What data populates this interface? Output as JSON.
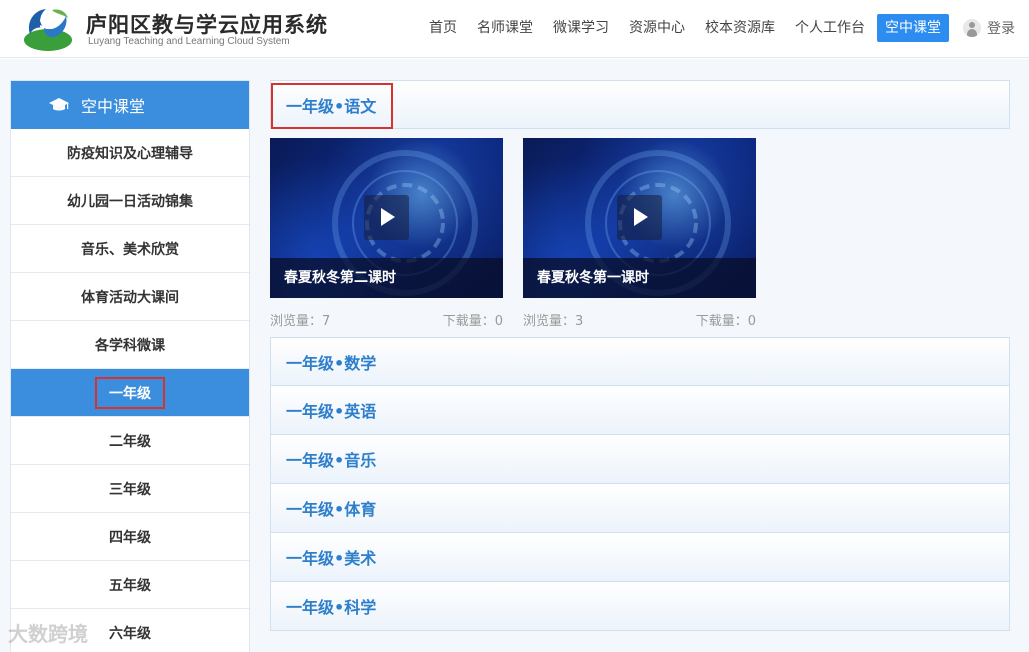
{
  "header": {
    "title": "庐阳区教与学云应用系统",
    "subtitle": "Luyang Teaching and Learning Cloud System",
    "nav": [
      "首页",
      "名师课堂",
      "微课学习",
      "资源中心",
      "校本资源库",
      "个人工作台",
      "空中课堂"
    ],
    "active_nav": "空中课堂",
    "login_label": "登录"
  },
  "sidebar": {
    "title": "空中课堂",
    "items": [
      "防疫知识及心理辅导",
      "幼儿园一日活动锦集",
      "音乐、美术欣赏",
      "体育活动大课间",
      "各学科微课",
      "一年级",
      "二年级",
      "三年级",
      "四年级",
      "五年级",
      "六年级"
    ],
    "active": "一年级"
  },
  "main": {
    "first_section": "一年级•语文",
    "videos": [
      {
        "title": "春夏秋冬第二课时",
        "views_label": "浏览量：",
        "views": "7",
        "downloads_label": "下载量：",
        "downloads": "0"
      },
      {
        "title": "春夏秋冬第一课时",
        "views_label": "浏览量：",
        "views": "3",
        "downloads_label": "下载量：",
        "downloads": "0"
      }
    ],
    "sections": [
      "一年级•数学",
      "一年级•英语",
      "一年级•音乐",
      "一年级•体育",
      "一年级•美术",
      "一年级•科学"
    ]
  },
  "watermark": "大数跨境",
  "colors": {
    "accent": "#3b8ede",
    "nav_active": "#2d8cf0",
    "section_text": "#2e7fcb",
    "highlight_border": "#d9312b"
  }
}
